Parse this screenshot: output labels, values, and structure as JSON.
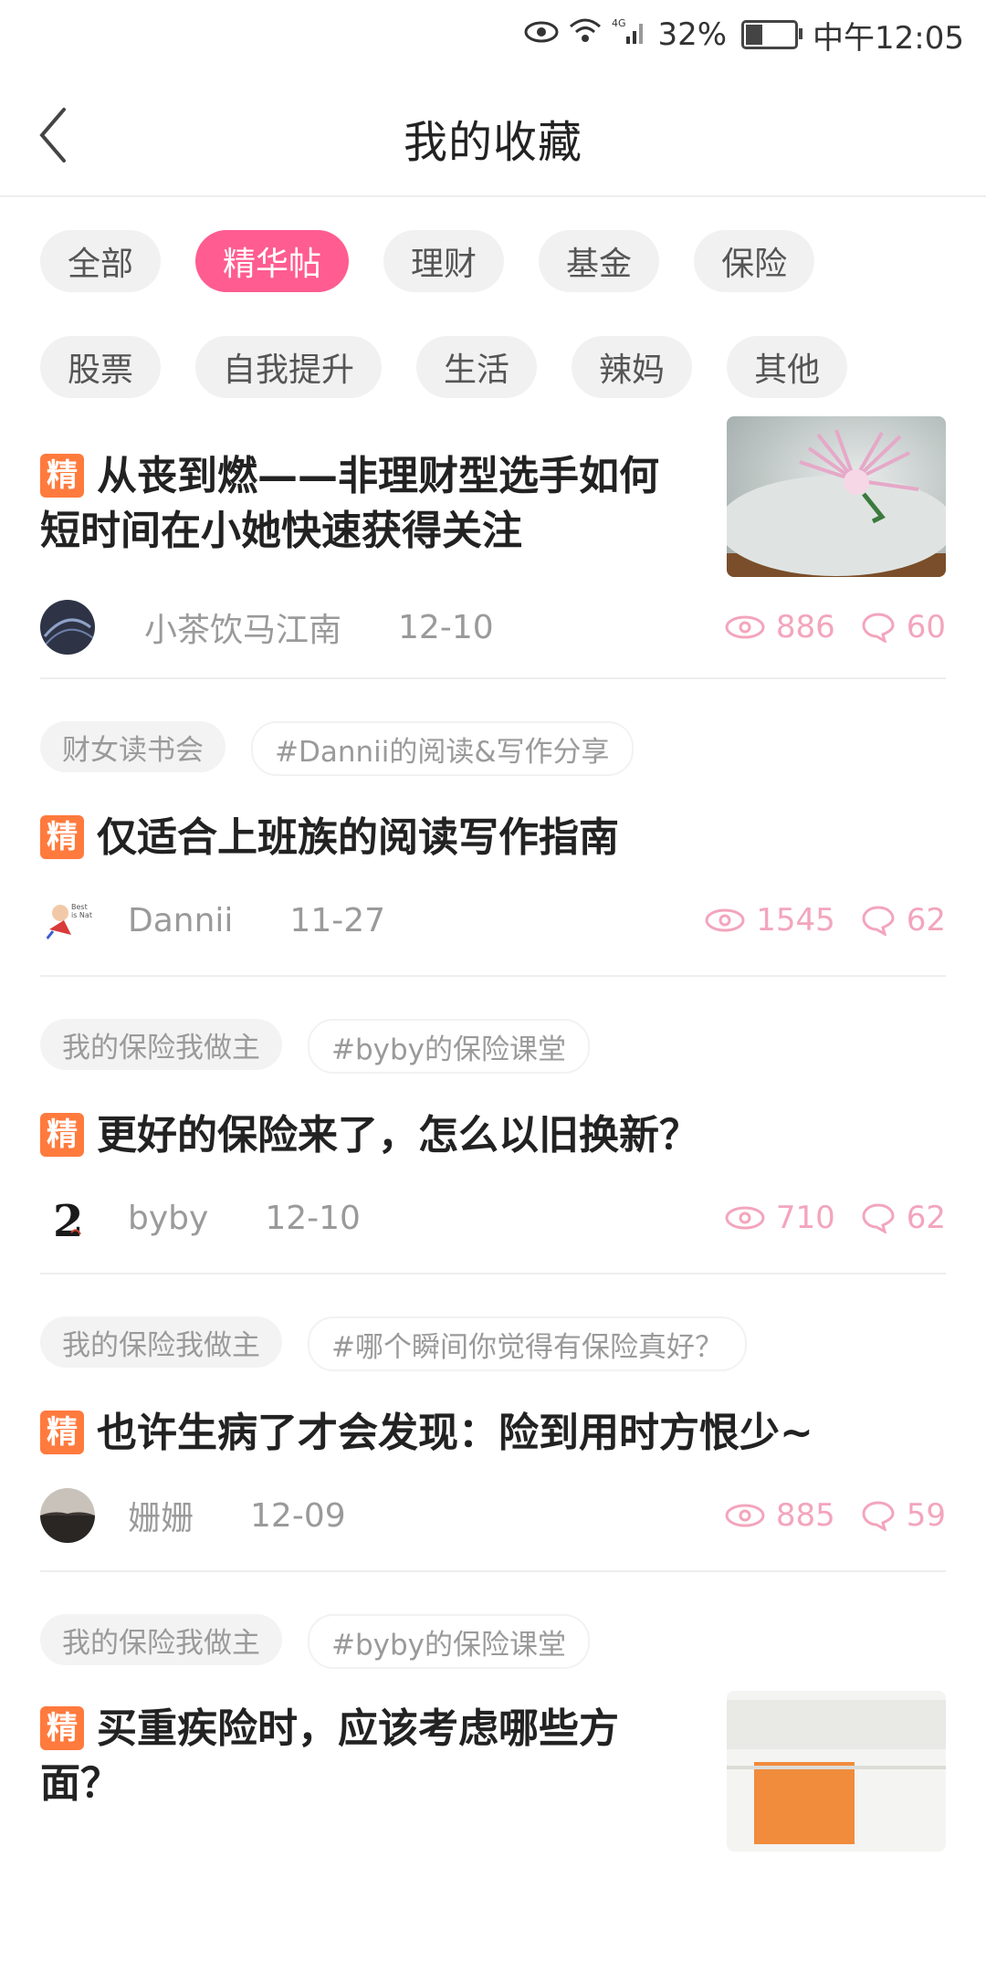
{
  "status_bar": {
    "battery": "32%",
    "time": "中午12:05"
  },
  "header": {
    "title": "我的收藏"
  },
  "filters": {
    "row1": [
      "全部",
      "精华帖",
      "理财",
      "基金",
      "保险"
    ],
    "row2": [
      "股票",
      "自我提升",
      "生活",
      "辣妈",
      "其他"
    ],
    "active": "精华帖"
  },
  "colors": {
    "accent": "#ff5c91",
    "badge": "#ff7a3d",
    "stats": "#f3a5bd"
  },
  "posts": [
    {
      "badge": "精",
      "title": "从丧到燃——非理财型选手如何短时间在小她快速获得关注",
      "author": "小茶饮马江南",
      "date": "12-10",
      "views": "886",
      "comments": "60"
    },
    {
      "tags": [
        "财女读书会",
        "#Dannii的阅读&写作分享"
      ],
      "badge": "精",
      "title": "仅适合上班族的阅读写作指南",
      "author": "Dannii",
      "date": "11-27",
      "views": "1545",
      "comments": "62"
    },
    {
      "tags": [
        "我的保险我做主",
        "#byby的保险课堂"
      ],
      "badge": "精",
      "title": "更好的保险来了，怎么以旧换新？",
      "author": "byby",
      "date": "12-10",
      "views": "710",
      "comments": "62"
    },
    {
      "tags": [
        "我的保险我做主",
        "#哪个瞬间你觉得有保险真好？"
      ],
      "badge": "精",
      "title": "也许生病了才会发现：险到用时方恨少~",
      "author": "姗姗",
      "date": "12-09",
      "views": "885",
      "comments": "59"
    },
    {
      "tags": [
        "我的保险我做主",
        "#byby的保险课堂"
      ],
      "badge": "精",
      "title": "买重疾险时，应该考虑哪些方面？"
    }
  ]
}
